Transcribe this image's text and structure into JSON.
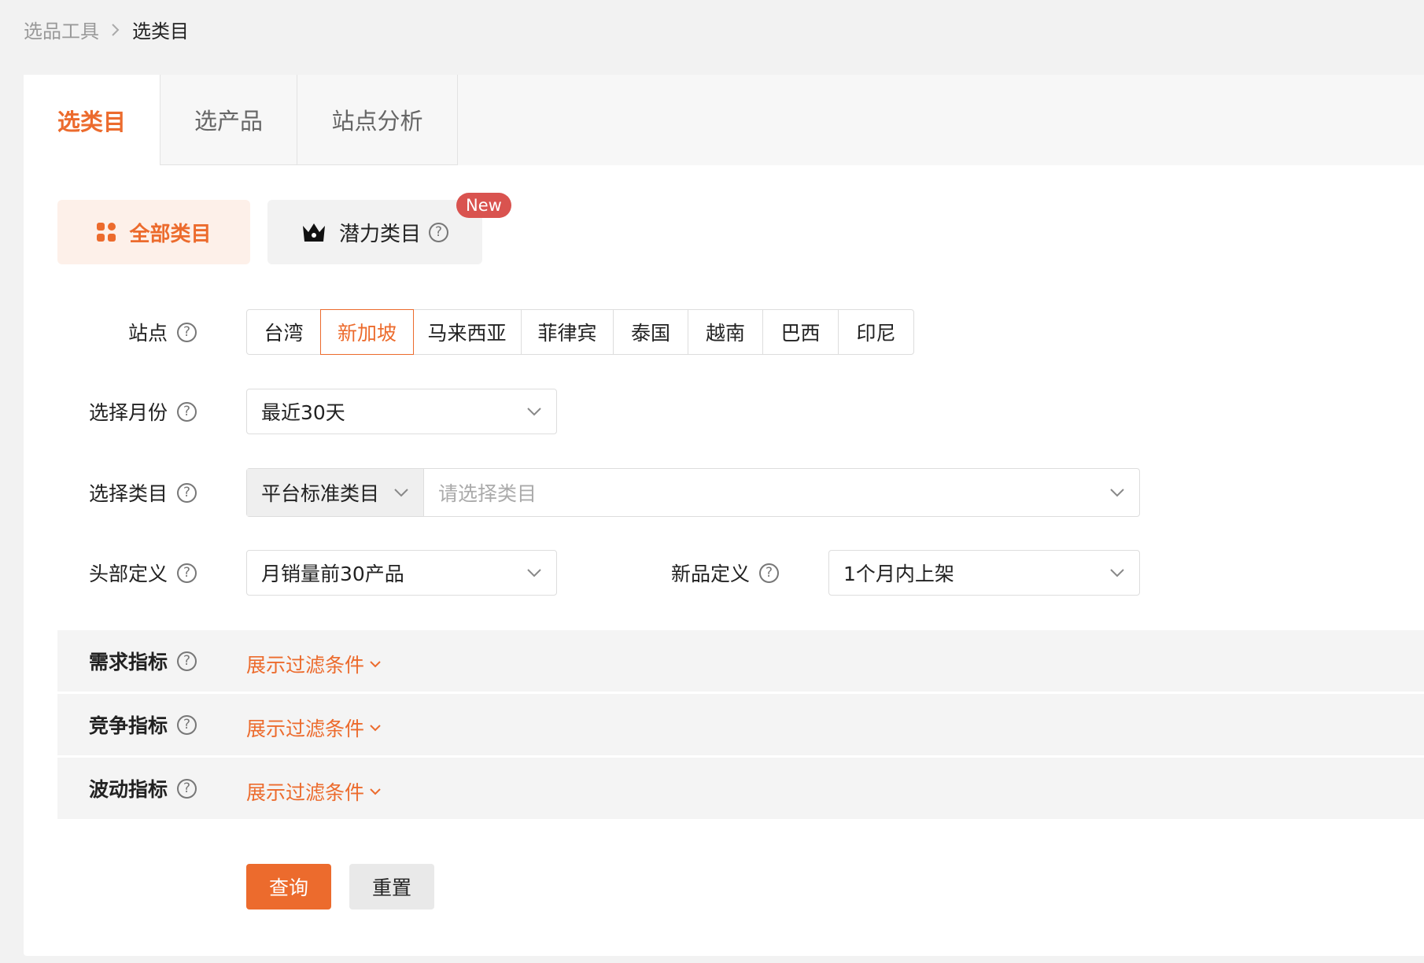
{
  "breadcrumb": {
    "root": "选品工具",
    "current": "选类目"
  },
  "tabs": [
    {
      "label": "选类目",
      "active": true
    },
    {
      "label": "选产品",
      "active": false
    },
    {
      "label": "站点分析",
      "active": false
    }
  ],
  "modes": {
    "all": {
      "label": "全部类目",
      "icon": "grid-icon"
    },
    "potential": {
      "label": "潜力类目",
      "icon": "crown-icon",
      "badge": "New"
    }
  },
  "form": {
    "site": {
      "label": "站点",
      "options": [
        "台湾",
        "新加坡",
        "马来西亚",
        "菲律宾",
        "泰国",
        "越南",
        "巴西",
        "印尼"
      ],
      "selected": "新加坡"
    },
    "month": {
      "label": "选择月份",
      "value": "最近30天"
    },
    "category": {
      "label": "选择类目",
      "type": "平台标准类目",
      "placeholder": "请选择类目"
    },
    "head": {
      "label": "头部定义",
      "value": "月销量前30产品"
    },
    "newdef": {
      "label": "新品定义",
      "value": "1个月内上架"
    }
  },
  "filters": [
    {
      "label": "需求指标",
      "link": "展示过滤条件"
    },
    {
      "label": "竞争指标",
      "link": "展示过滤条件"
    },
    {
      "label": "波动指标",
      "link": "展示过滤条件"
    }
  ],
  "actions": {
    "query": "查询",
    "reset": "重置"
  },
  "colors": {
    "accent": "#ec6b2d",
    "badge": "#d9534f"
  }
}
